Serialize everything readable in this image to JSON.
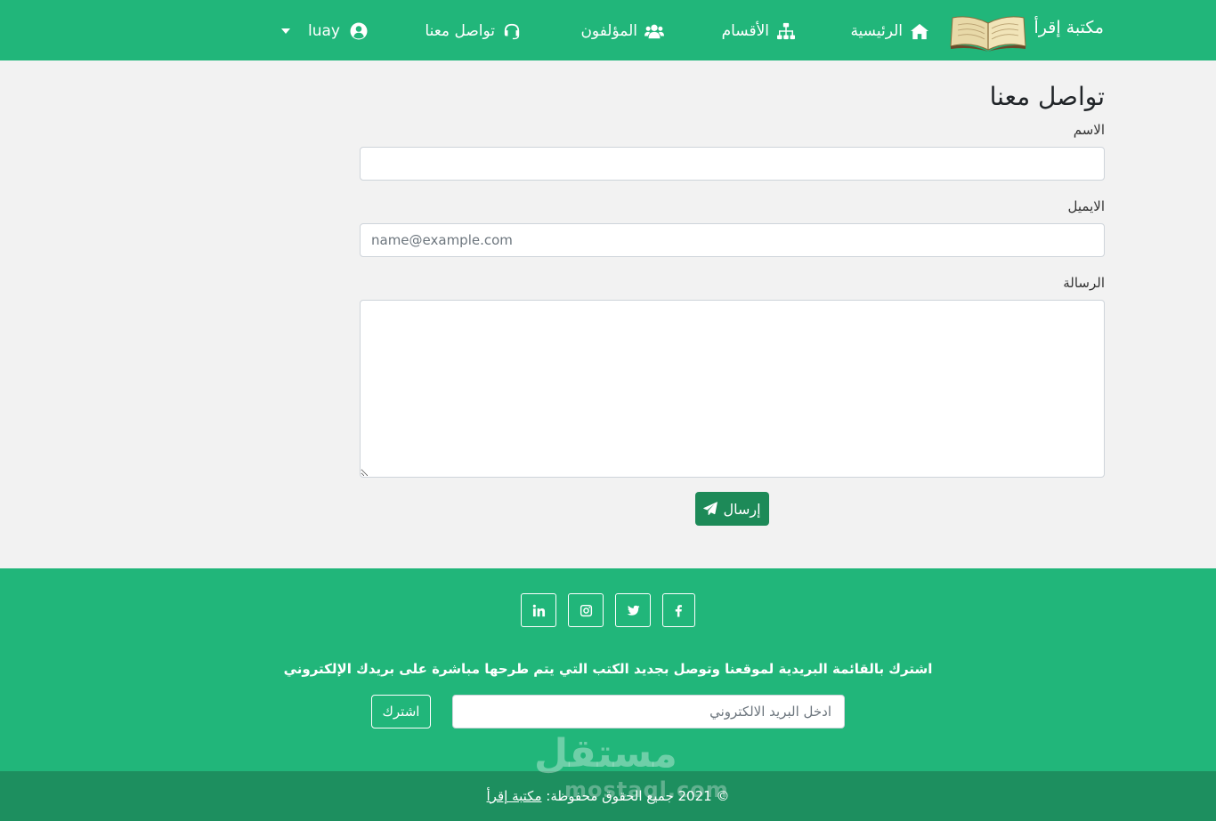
{
  "navbar": {
    "brand": "مكتبة إقرأ",
    "home": "الرئيسية",
    "categories": "الأقسام",
    "authors": "المؤلفون",
    "contact": "تواصل معنا",
    "user": "luay",
    "icons": [
      "book-logo",
      "home-icon",
      "sitemap-icon",
      "users-icon",
      "headset-icon",
      "user-circle-icon",
      "caret-down-icon"
    ]
  },
  "contact_form": {
    "title": "تواصل معنا",
    "name_label": "الاسم",
    "name_value": "",
    "email_label": "الايميل",
    "email_placeholder": "name@example.com",
    "message_label": "الرسالة",
    "message_value": "",
    "send_label": "إرسال"
  },
  "footer": {
    "social_icons": [
      "facebook-icon",
      "twitter-icon",
      "instagram-icon",
      "linkedin-icon"
    ],
    "subscribe_text": "اشترك بالقائمة البريدية لموقعنا وتوصل بجديد الكتب التي يتم طرحها مباشرة على بريدك الإلكتروني",
    "email_placeholder": "ادخل البريد الالكتروني",
    "subscribe_button": "اشترك",
    "copyright_prefix": "© 2021 جميع الحقوق محفوظة:",
    "copyright_link": "مكتبة إقرأ"
  },
  "watermark": {
    "arabic": "مستقل",
    "latin": "mostaql.com"
  },
  "colors": {
    "primary": "#21b67a",
    "button_dark": "#1d8a58",
    "footer_bottom": "#1d8f5f",
    "page_bg": "#f2f2f2"
  }
}
